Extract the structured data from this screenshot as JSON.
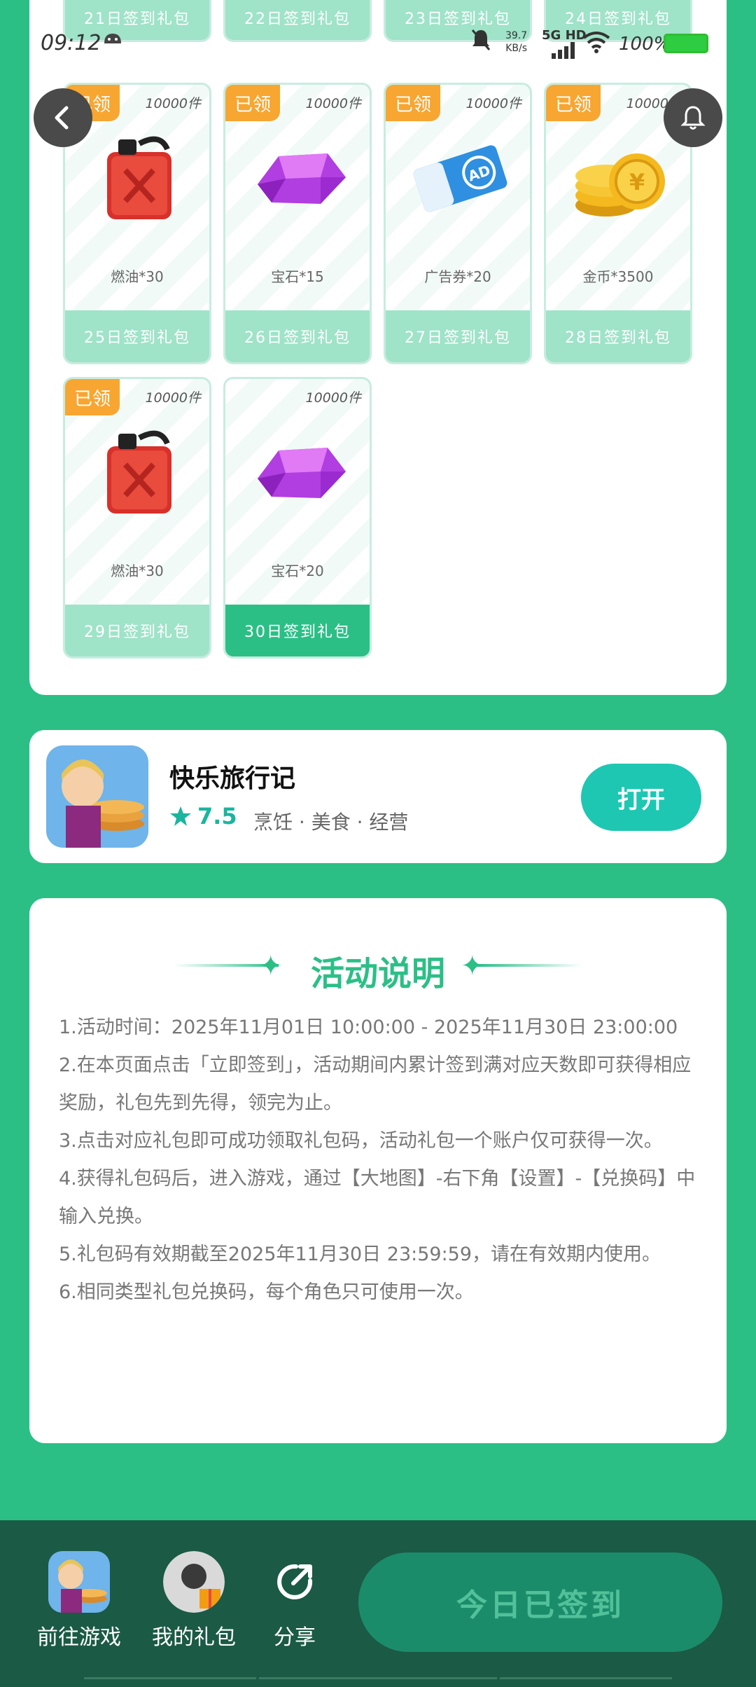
{
  "status": {
    "time": "09:12",
    "net_speed_value": "39.7",
    "net_speed_unit": "KB/s",
    "network": "5G HD",
    "battery": "100%"
  },
  "gifts_top_row": [
    {
      "footer": "21日签到礼包"
    },
    {
      "footer": "22日签到礼包"
    },
    {
      "footer": "23日签到礼包"
    },
    {
      "footer": "24日签到礼包"
    }
  ],
  "gifts": [
    {
      "badge": "已领",
      "stock": "10000件",
      "name": "燃油*30",
      "footer": "25日签到礼包",
      "icon": "fuel-can"
    },
    {
      "badge": "已领",
      "stock": "10000件",
      "name": "宝石*15",
      "footer": "26日签到礼包",
      "icon": "gem"
    },
    {
      "badge": "已领",
      "stock": "10000件",
      "name": "广告券*20",
      "footer": "27日签到礼包",
      "icon": "ad-ticket"
    },
    {
      "badge": "已领",
      "stock": "10000件",
      "name": "金币*3500",
      "footer": "28日签到礼包",
      "icon": "gold-coins"
    },
    {
      "badge": "已领",
      "stock": "10000件",
      "name": "燃油*30",
      "footer": "29日签到礼包",
      "icon": "fuel-can"
    },
    {
      "badge": "",
      "stock": "10000件",
      "name": "宝石*20",
      "footer": "30日签到礼包",
      "icon": "gem"
    }
  ],
  "game": {
    "title": "快乐旅行记",
    "rating": "7.5",
    "tags": "烹饪 · 美食 · 经营",
    "open_label": "打开"
  },
  "description": {
    "title": "活动说明",
    "rules": [
      "1.活动时间：2025年11月01日 10:00:00 - 2025年11月30日 23:00:00",
      "2.在本页面点击「立即签到」，活动期间内累计签到满对应天数即可获得相应奖励，礼包先到先得，领完为止。",
      "3.点击对应礼包即可成功领取礼包码，活动礼包一个账户仅可获得一次。",
      "4.获得礼包码后，进入游戏，通过【大地图】-右下角【设置】-【兑换码】中输入兑换。",
      "5.礼包码有效期截至2025年11月30日 23:59:59，请在有效期内使用。",
      "6.相同类型礼包兑换码，每个角色只可使用一次。"
    ]
  },
  "bottom": {
    "items": [
      {
        "label": "前往游戏"
      },
      {
        "label": "我的礼包"
      },
      {
        "label": "分享"
      }
    ],
    "cta": "今日已签到"
  },
  "colors": {
    "page_bg": "#2bbf86",
    "badge": "#f7a631",
    "footer_inactive": "#9fe3c9",
    "footer_active": "#2bbf86",
    "open_button": "#1ec7b2",
    "bottom_bar": "#1b5a45"
  }
}
